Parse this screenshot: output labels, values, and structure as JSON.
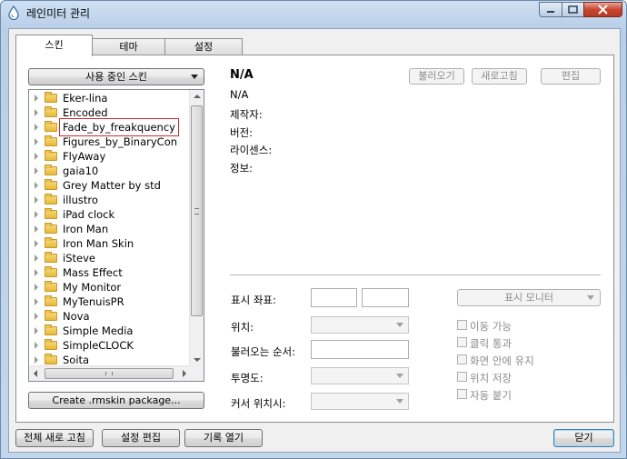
{
  "window": {
    "title": "레인미터 관리"
  },
  "tabs": [
    {
      "label": "스킨"
    },
    {
      "label": "테마"
    },
    {
      "label": "설정"
    }
  ],
  "left": {
    "active_skins_label": "사용 중인 스킨",
    "create_label": "Create .rmskin package...",
    "tree_items": [
      {
        "label": "Eker-lina"
      },
      {
        "label": "Encoded"
      },
      {
        "label": "Fade_by_freakquency"
      },
      {
        "label": "Figures_by_BinaryCon"
      },
      {
        "label": "FlyAway"
      },
      {
        "label": "gaia10"
      },
      {
        "label": "Grey Matter by std"
      },
      {
        "label": "illustro"
      },
      {
        "label": "iPad clock"
      },
      {
        "label": "Iron Man"
      },
      {
        "label": "Iron Man Skin"
      },
      {
        "label": "iSteve"
      },
      {
        "label": "Mass Effect"
      },
      {
        "label": "My Monitor"
      },
      {
        "label": "MyTenuisPR"
      },
      {
        "label": "Nova"
      },
      {
        "label": "Simple Media"
      },
      {
        "label": "SimpleCLOCK"
      },
      {
        "label": "Soita"
      }
    ]
  },
  "right": {
    "skin_name": "N/A",
    "skin_file": "N/A",
    "meta": {
      "author": "제작자:",
      "version": "버전:",
      "license": "라이센스:",
      "info": "정보:"
    },
    "buttons": {
      "load": "불러오기",
      "refresh": "새로고침",
      "edit": "편집"
    },
    "form": {
      "coords_label": "표시 좌표:",
      "position_label": "위치:",
      "load_order_label": "불러오는 순서:",
      "transparency_label": "투명도:",
      "cursor_label": "커서 위치시:",
      "monitor_label": "표시 모니터"
    },
    "checks": [
      {
        "label": "이동 가능"
      },
      {
        "label": "클릭 통과"
      },
      {
        "label": "화면 안에 유지"
      },
      {
        "label": "위치 저장"
      },
      {
        "label": "자동 붙기"
      }
    ]
  },
  "footer": {
    "refresh_all": "전체 새로 고침",
    "edit_settings": "설정 편집",
    "open_log": "기록 열기",
    "close": "닫기"
  }
}
